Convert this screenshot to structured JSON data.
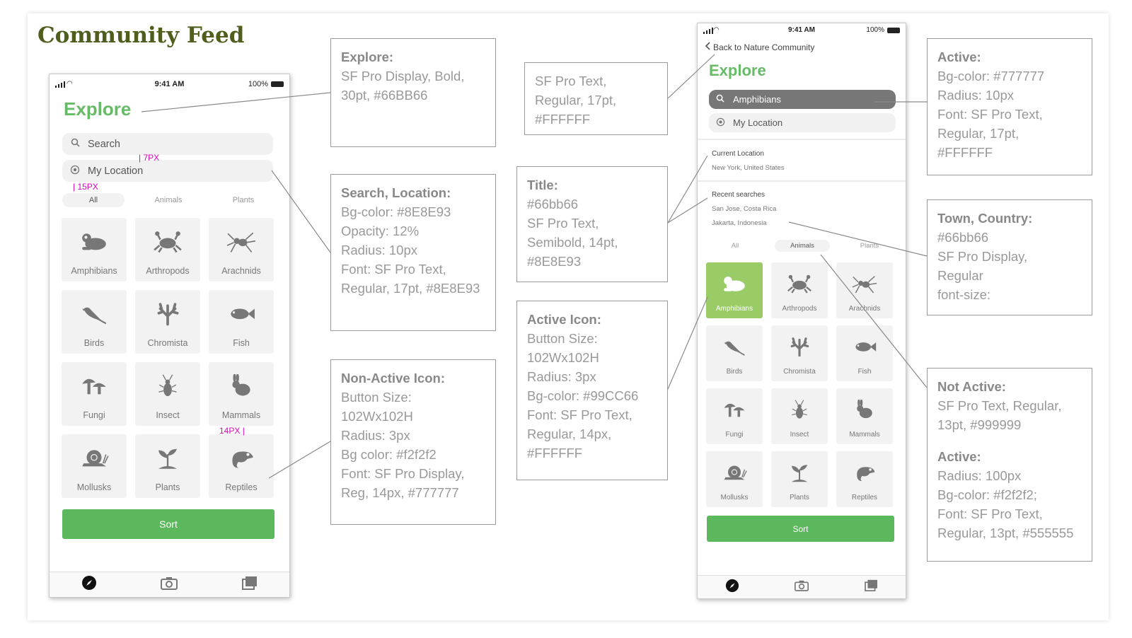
{
  "page_title": "Community Feed",
  "status": {
    "time": "9:41 AM",
    "battery": "100%"
  },
  "left_phone": {
    "title": "Explore",
    "search_placeholder": "Search",
    "location_placeholder": "My Location",
    "tabs": [
      "All",
      "Animals",
      "Plants"
    ],
    "categories": [
      "Amphibians",
      "Arthropods",
      "Arachnids",
      "Birds",
      "Chromista",
      "Fish",
      "Fungi",
      "Insect",
      "Mammals",
      "Mollusks",
      "Plants",
      "Reptiles"
    ],
    "sort_label": "Sort",
    "measure_7": "7PX",
    "measure_15": "15PX",
    "measure_14": "14PX"
  },
  "right_phone": {
    "back_label": "Back to Nature Community",
    "title": "Explore",
    "search_value": "Amphibians",
    "location_placeholder": "My Location",
    "current_location_heading": "Current Location",
    "current_location_value": "New York, United States",
    "recent_heading": "Recent searches",
    "recent": [
      "San Jose, Costa Rica",
      "Jakarta, Indonesia"
    ],
    "tabs": [
      "All",
      "Animals",
      "Plants"
    ],
    "active_tab_index": 1,
    "categories": [
      "Amphibians",
      "Arthropods",
      "Arachnids",
      "Birds",
      "Chromista",
      "Fish",
      "Fungi",
      "Insect",
      "Mammals",
      "Mollusks",
      "Plants",
      "Reptiles"
    ],
    "active_category_index": 0,
    "sort_label": "Sort"
  },
  "notes": {
    "explore": {
      "title": "Explore:",
      "lines": [
        "SF Pro Display, Bold,",
        "30pt, #66BB66"
      ]
    },
    "search_location": {
      "title": "Search, Location:",
      "lines": [
        "Bg-color: #8E8E93",
        "Opacity: 12%",
        "Radius: 10px",
        "Font: SF Pro Text,",
        "Regular, 17pt, #8E8E93"
      ]
    },
    "non_active_icon": {
      "title": "Non-Active Icon:",
      "lines": [
        "Button Size:",
        "102Wx102H",
        "Radius: 3px",
        "Bg color: #f2f2f2",
        "Font: SF Pro Display,",
        "Reg, 14px, #777777"
      ]
    },
    "sf_text": {
      "lines": [
        "SF Pro Text,",
        "Regular, 17pt,",
        "#FFFFFF"
      ]
    },
    "title_note": {
      "title": "Title:",
      "lines": [
        "#66bb66",
        "SF Pro Text,",
        "Semibold, 14pt,",
        "#8E8E93"
      ]
    },
    "active_icon": {
      "title": "Active Icon:",
      "lines": [
        "Button Size:",
        "102Wx102H",
        "Radius: 3px",
        "Bg-color: #99CC66",
        "Font: SF Pro Text,",
        "Regular, 14px,",
        "#FFFFFF"
      ]
    },
    "active": {
      "title": "Active:",
      "lines": [
        "Bg-color: #777777",
        "Radius: 10px",
        "Font: SF Pro Text,",
        "Regular, 17pt,",
        "#FFFFFF"
      ]
    },
    "town_country": {
      "title": "Town, Country:",
      "lines": [
        "#66bb66",
        "SF Pro Display,",
        "Regular",
        "font-size:"
      ]
    },
    "not_active": {
      "title": "Not Active:",
      "lines": [
        "SF Pro Text, Regular,",
        "13pt, #999999"
      ],
      "title2": "Active:",
      "lines2": [
        "Radius: 100px",
        "Bg-color: #f2f2f2;",
        "Font: SF Pro Text,",
        "Regular, 13pt, #555555"
      ]
    }
  },
  "icons": [
    "frog-icon",
    "crab-icon",
    "spider-icon",
    "bird-icon",
    "coral-icon",
    "fish-icon",
    "mushroom-icon",
    "beetle-icon",
    "rabbit-icon",
    "snail-icon",
    "sprout-icon",
    "chameleon-icon",
    "compass-icon",
    "camera-icon",
    "gallery-icon",
    "search-icon",
    "location-icon",
    "chevron-left-icon"
  ],
  "colors": {
    "accent": "#66bb66",
    "sort_green": "#5cb85c",
    "active_tile": "#99cc66",
    "active_field": "#777777",
    "tile_bg": "#f2f2f2"
  }
}
